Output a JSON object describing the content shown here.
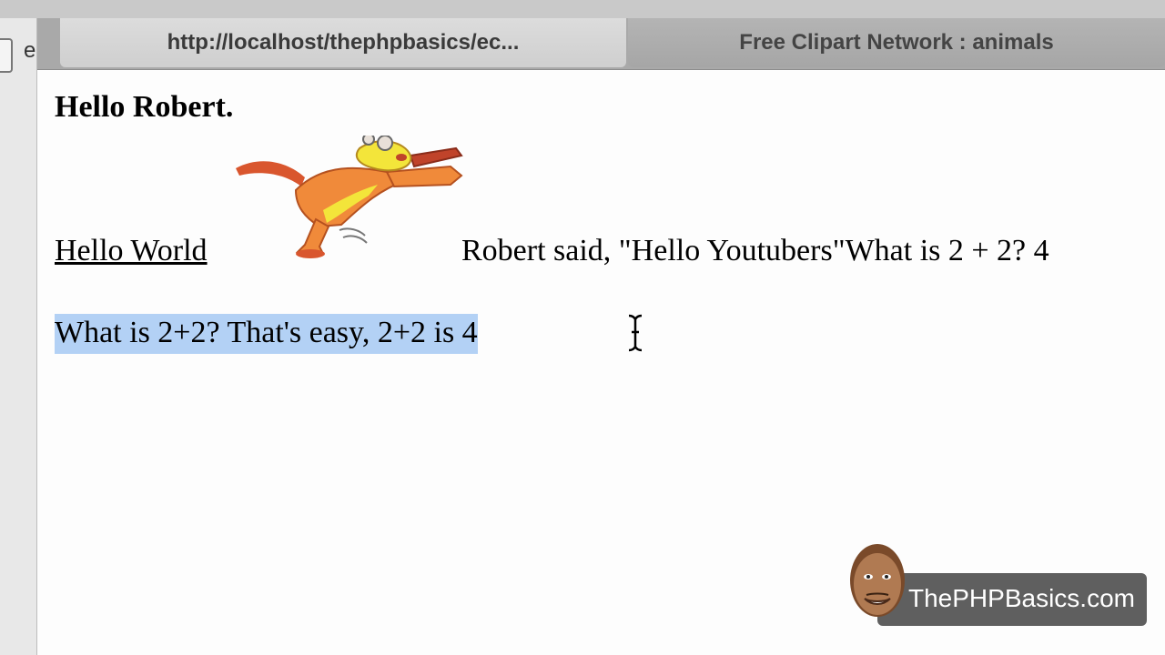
{
  "tabs": [
    {
      "label": "http://localhost/thephpbasics/ec...",
      "active": true
    },
    {
      "label": "Free Clipart Network : animals",
      "active": false
    }
  ],
  "sidebar_letter": "e",
  "page": {
    "greeting": "Hello Robert.",
    "link_text": "Hello World",
    "line_text": "Robert said, \"Hello Youtubers\"What is 2 + 2? 4",
    "selected_text": "What is 2+2? That's easy, 2+2 is 4"
  },
  "watermark": {
    "text": "ThePHPBasics.com"
  },
  "colors": {
    "selection": "#b3d1f5",
    "tabbar": "#a9a9a9"
  }
}
